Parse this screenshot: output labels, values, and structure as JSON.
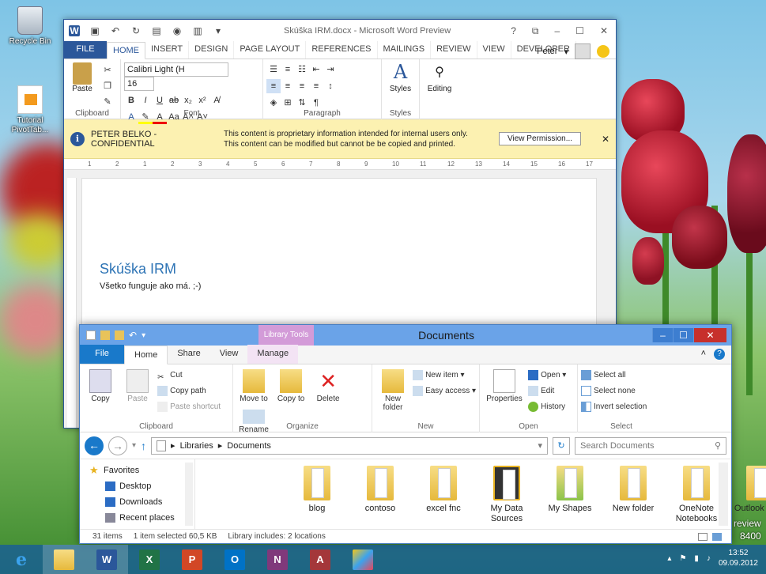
{
  "desktop": {
    "icons": [
      {
        "label": "Recycle Bin"
      },
      {
        "label": "Tutorial PivotTab..."
      }
    ],
    "watermark": {
      "line1": "review",
      "line2": "8400"
    }
  },
  "word": {
    "title": "Skúška IRM.docx - Microsoft Word Preview",
    "window_controls": {
      "help": "?",
      "restore": "⧉",
      "minimize": "–",
      "maximize": "☐",
      "close": "✕"
    },
    "tabs": [
      "FILE",
      "HOME",
      "INSERT",
      "DESIGN",
      "PAGE LAYOUT",
      "REFERENCES",
      "MAILINGS",
      "REVIEW",
      "VIEW",
      "DEVELOPER"
    ],
    "user": "Peter",
    "ribbon": {
      "paste_label": "Paste",
      "clipboard": "Clipboard",
      "font_name": "Calibri Light (H",
      "font_size": "16",
      "font": "Font",
      "paragraph": "Paragraph",
      "styles_label": "Styles",
      "styles_group": "Styles",
      "editing_label": "Editing"
    },
    "infobar": {
      "label": "PETER BELKO - CONFIDENTIAL",
      "message": "This content is proprietary information intended for internal users only. This content can be modified but cannot be be copied and printed.",
      "button": "View Permission..."
    },
    "ruler_numbers": [
      "1",
      "2",
      "1",
      "2",
      "3",
      "4",
      "5",
      "6",
      "7",
      "8",
      "9",
      "10",
      "11",
      "12",
      "13",
      "14",
      "15",
      "16",
      "17"
    ],
    "doc": {
      "heading": "Skúška IRM",
      "body": "Všetko funguje ako má. ;-)"
    }
  },
  "explorer": {
    "title": "Documents",
    "library_tools": "Library Tools",
    "tabs": [
      "File",
      "Home",
      "Share",
      "View",
      "Manage"
    ],
    "ribbon": {
      "copy": "Copy",
      "paste": "Paste",
      "cut": "Cut",
      "copy_path": "Copy path",
      "paste_shortcut": "Paste shortcut",
      "clipboard": "Clipboard",
      "move_to": "Move to",
      "copy_to": "Copy to",
      "delete": "Delete",
      "rename": "Rename",
      "organize": "Organize",
      "new_folder": "New folder",
      "new_item": "New item",
      "easy_access": "Easy access",
      "new": "New",
      "properties": "Properties",
      "open_btn": "Open",
      "edit": "Edit",
      "history": "History",
      "open": "Open",
      "select_all": "Select all",
      "select_none": "Select none",
      "invert_selection": "Invert selection",
      "select": "Select"
    },
    "address": {
      "crumbs": [
        "Libraries",
        "Documents"
      ],
      "search_placeholder": "Search Documents"
    },
    "nav": [
      "Favorites",
      "Desktop",
      "Downloads",
      "Recent places"
    ],
    "files": [
      "blog",
      "contoso",
      "excel fnc",
      "My Data Sources",
      "My Shapes",
      "New folder",
      "OneNote Notebooks",
      "Outlook Files"
    ],
    "status": {
      "items": "31 items",
      "selected": "1 item selected  60,5 KB",
      "library": "Library includes: 2 locations"
    }
  },
  "taskbar": {
    "apps": [
      "Internet Explorer",
      "File Explorer",
      "Word",
      "Excel",
      "PowerPoint",
      "Outlook",
      "OneNote",
      "Access",
      "Paint"
    ],
    "time": "13:52",
    "date": "09.09.2012"
  }
}
